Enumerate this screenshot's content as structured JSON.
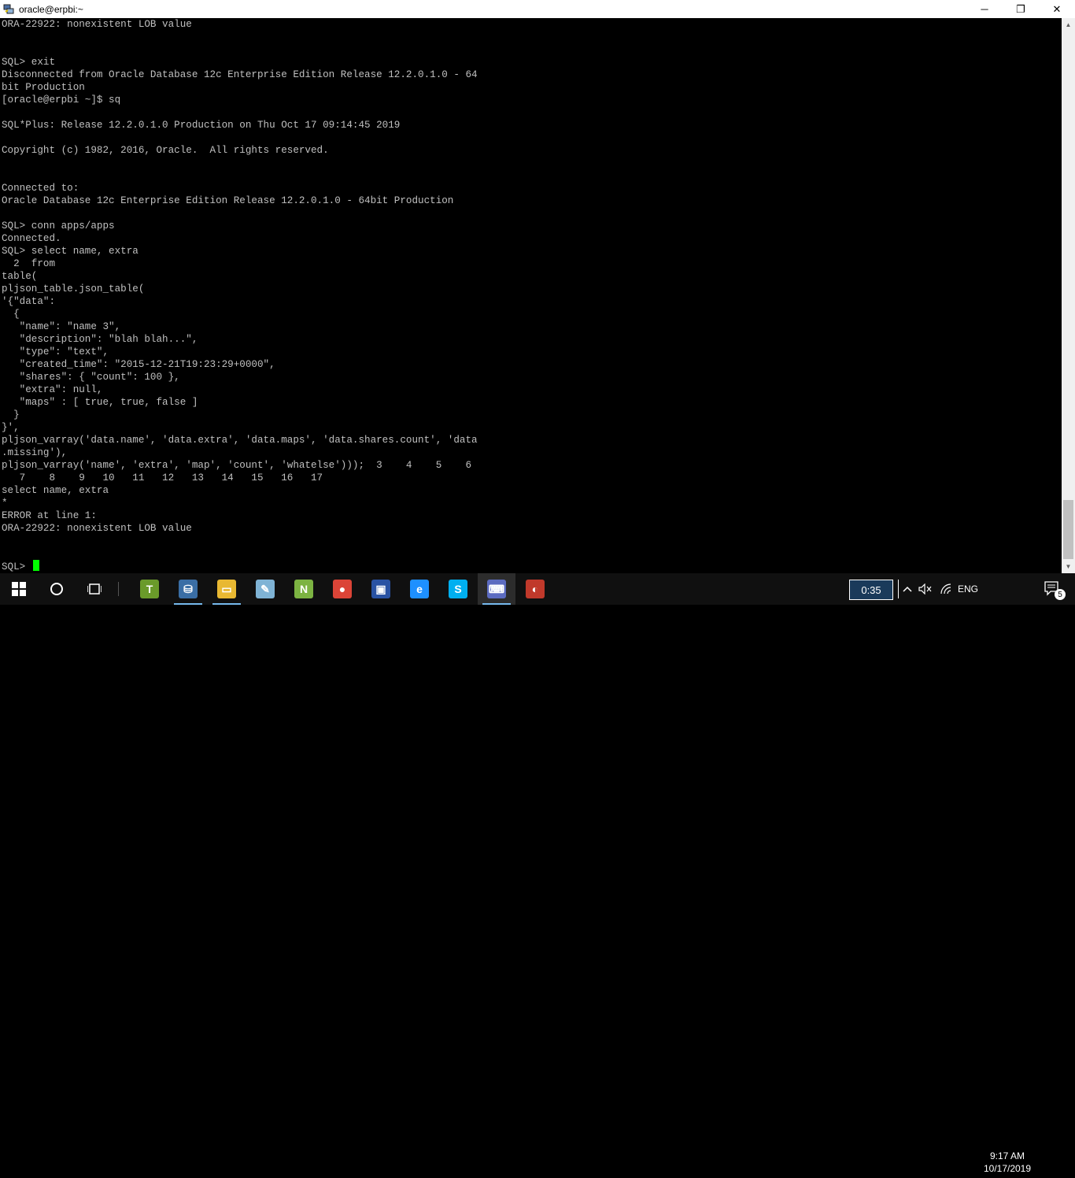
{
  "window": {
    "title": "oracle@erpbi:~",
    "icon": "putty-icon",
    "controls": {
      "minimize": "─",
      "restore": "❐",
      "close": "✕"
    }
  },
  "terminal": {
    "lines": [
      "ORA-22922: nonexistent LOB value",
      "",
      "",
      "SQL> exit",
      "Disconnected from Oracle Database 12c Enterprise Edition Release 12.2.0.1.0 - 64",
      "bit Production",
      "[oracle@erpbi ~]$ sq",
      "",
      "SQL*Plus: Release 12.2.0.1.0 Production on Thu Oct 17 09:14:45 2019",
      "",
      "Copyright (c) 1982, 2016, Oracle.  All rights reserved.",
      "",
      "",
      "Connected to:",
      "Oracle Database 12c Enterprise Edition Release 12.2.0.1.0 - 64bit Production",
      "",
      "SQL> conn apps/apps",
      "Connected.",
      "SQL> select name, extra",
      "  2  from",
      "table(",
      "pljson_table.json_table(",
      "'{\"data\":",
      "  {",
      "   \"name\": \"name 3\",",
      "   \"description\": \"blah blah...\",",
      "   \"type\": \"text\",",
      "   \"created_time\": \"2015-12-21T19:23:29+0000\",",
      "   \"shares\": { \"count\": 100 },",
      "   \"extra\": null,",
      "   \"maps\" : [ true, true, false ]",
      "  }",
      "}',",
      "pljson_varray('data.name', 'data.extra', 'data.maps', 'data.shares.count', 'data",
      ".missing'),",
      "pljson_varray('name', 'extra', 'map', 'count', 'whatelse')));  3    4    5    6",
      "   7    8    9   10   11   12   13   14   15   16   17",
      "select name, extra",
      "*",
      "ERROR at line 1:",
      "ORA-22922: nonexistent LOB value",
      "",
      ""
    ],
    "prompt": "SQL> ",
    "cursor_color": "#00ff00"
  },
  "taskbar": {
    "apps": [
      {
        "name": "toad-icon",
        "glyph": "T",
        "color": "#6a9a2a"
      },
      {
        "name": "network-drive-icon",
        "glyph": "⛁",
        "color": "#3a6ea5"
      },
      {
        "name": "file-explorer-icon",
        "glyph": "▭",
        "color": "#e8b832"
      },
      {
        "name": "notepad-icon",
        "glyph": "✎",
        "color": "#7fb3d5"
      },
      {
        "name": "notepad-plus-plus-icon",
        "glyph": "N",
        "color": "#7cb342"
      },
      {
        "name": "chrome-icon",
        "glyph": "●",
        "color": "#db4437"
      },
      {
        "name": "save-icon",
        "glyph": "▣",
        "color": "#2952a3"
      },
      {
        "name": "internet-explorer-icon",
        "glyph": "e",
        "color": "#1e90ff"
      },
      {
        "name": "skype-icon",
        "glyph": "S",
        "color": "#00aff0"
      },
      {
        "name": "putty-icon",
        "glyph": "⌨",
        "color": "#5c6bc0"
      },
      {
        "name": "sql-developer-icon",
        "glyph": "◐",
        "color": "#c0392b"
      }
    ],
    "timer": "0:35",
    "language": "ENG",
    "time": "9:17 AM",
    "date": "10/17/2019",
    "notifications": "5"
  }
}
